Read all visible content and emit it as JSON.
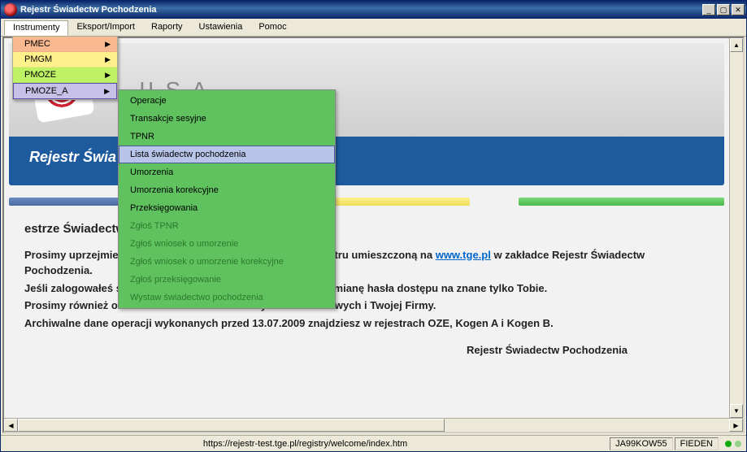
{
  "window": {
    "title": "Rejestr Świadectw Pochodzenia"
  },
  "menubar": {
    "instrumenty": "Instrumenty",
    "eksport": "Eksport/Import",
    "raporty": "Raporty",
    "ustawienia": "Ustawienia",
    "pomoc": "Pomoc"
  },
  "dropdown": {
    "pmec": "PMEC",
    "pmgm": "PMGM",
    "pmoze": "PMOZE",
    "pmoze_a": "PMOZE_A"
  },
  "submenu": {
    "operacje": "Operacje",
    "transakcje": "Transakcje sesyjne",
    "tpnr": "TPNR",
    "lista": "Lista świadectw pochodzenia",
    "umorzenia": "Umorzenia",
    "umorzenia_kor": "Umorzenia korekcyjne",
    "przeksiegowania": "Przeksięgowania",
    "zglos_tpnr": "Zgłoś TPNR",
    "zglos_wn_um": "Zgłoś wniosek o umorzenie",
    "zglos_wn_um_kor": "Zgłoś wniosek o umorzenie korekcyjne",
    "zglos_przeks": "Zgłoś przeksięgowanie",
    "wystaw": "Wystaw świadectwo pochodzenia"
  },
  "banner": {
    "logo_text": "II S.A.",
    "subtitle": "Rejestr Świa"
  },
  "body": {
    "welcome": "estrze Świadectw Pochodzenia!",
    "p1a": "Prosimy uprzejmie o zapoznanie się z instrukcją obsługi rejestru umieszczoną na ",
    "link": "www.tge.pl",
    "p1b": " w zakładce Rejestr Świadectw Pochodzenia.",
    "p2": "Jeśli zalogowałeś się w rejestrze po raz pierwszy, prosimy o zmianę hasła dostępu na znane tylko Tobie.",
    "p3": "Prosimy również o zaktualizowanie Twoich danych teleadresowych i Twojej Firmy.",
    "p4": "Archiwalne dane operacji wykonanych przed 13.07.2009 znajdziesz w rejestrach OZE, Kogen A i Kogen B.",
    "sign": "Rejestr Świadectw Pochodzenia"
  },
  "statusbar": {
    "url": "https://rejestr-test.tge.pl/registry/welcome/index.htm",
    "user": "JA99KOW55",
    "label2": "FIEDEN"
  }
}
